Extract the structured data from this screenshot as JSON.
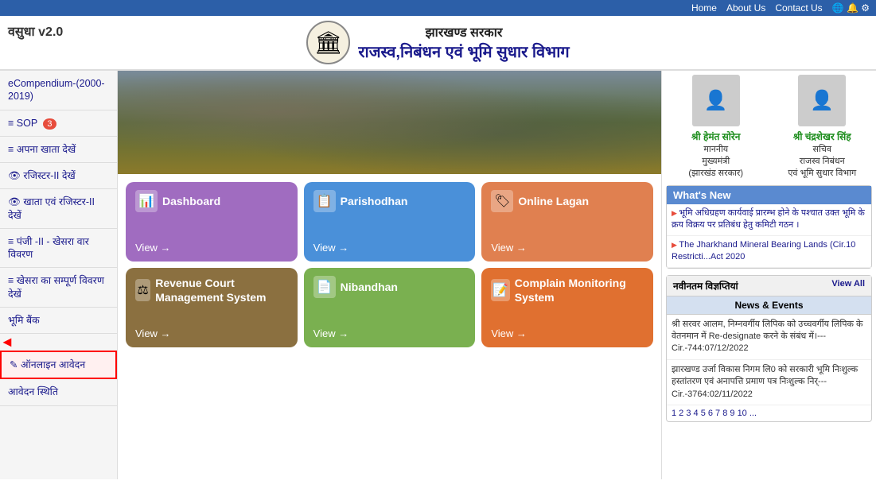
{
  "topnav": {
    "home": "Home",
    "about": "About Us",
    "contact": "Contact Us"
  },
  "brand": "वसुधा v2.0",
  "header": {
    "subtitle": "झारखण्ड सरकार",
    "main_title": "राजस्व,निबंधन एवं भूमि सुधार विभाग"
  },
  "sidebar": {
    "items": [
      {
        "id": "ecompendium",
        "label": "eCompendium-(2000-2019)"
      },
      {
        "id": "sop",
        "label": "SOP",
        "badge": "3"
      },
      {
        "id": "apna-khata",
        "label": "अपना खाता देखें"
      },
      {
        "id": "register2",
        "label": "रजिस्टर-II देखें"
      },
      {
        "id": "khata-register",
        "label": "खाता एवं रजिस्टर-II देखें"
      },
      {
        "id": "panji",
        "label": "पंजी -II - खेसरा वार विवरण"
      },
      {
        "id": "khesra-sampurn",
        "label": "खेसरा का सम्पूर्ण विवरण देखें"
      },
      {
        "id": "bhumi-bank",
        "label": "भूमि बैंक"
      },
      {
        "id": "online-avedan",
        "label": "ऑनलाइन आवेदन",
        "highlighted": true
      },
      {
        "id": "avedan-sthiti",
        "label": "आवेदन स्थिति"
      }
    ]
  },
  "modules": [
    {
      "id": "dashboard",
      "title": "Dashboard",
      "view": "View →",
      "class": "card-dashboard",
      "icon": "📊"
    },
    {
      "id": "parishodhan",
      "title": "Parishodhan",
      "view": "View →",
      "class": "card-parishodhan",
      "icon": "📋"
    },
    {
      "id": "online-lagan",
      "title": "Online Lagan",
      "view": "View →",
      "class": "card-lagan",
      "icon": "🏷"
    },
    {
      "id": "revenue-court",
      "title": "Revenue Court Management System",
      "view": "View →",
      "class": "card-revenue",
      "icon": "⚖"
    },
    {
      "id": "nibandhan",
      "title": "Nibandhan",
      "view": "View →",
      "class": "card-nibandhan",
      "icon": "📄"
    },
    {
      "id": "complain",
      "title": "Complain Monitoring System",
      "view": "View →",
      "class": "card-complain",
      "icon": "📝"
    }
  ],
  "officials": [
    {
      "id": "hemant-soren",
      "name": "श्री हेमंत सोरेन",
      "post1": "माननीय",
      "post2": "मुख्यमंत्री",
      "post3": "(झारखंड सरकार)",
      "emoji": "👤"
    },
    {
      "id": "chandreshekhar",
      "name": "श्री चंद्रशेखर सिंह",
      "post1": "सचिव",
      "post2": "राजस्व निबंधन",
      "post3": "एवं भूमि सुधार विभाग",
      "emoji": "👤"
    }
  ],
  "whats_new": {
    "title": "What's New",
    "items": [
      "भूमि अधिग्रहण कार्यवाई प्रारम्भ होने के पश्चात उक्त भूमि के क्रय विक्रय पर प्रतिबंध हेतु कमिटी गठन ।",
      "The Jharkhand Mineral Bearing Lands (Cir.10 Restricti...Act 2020"
    ]
  },
  "navinatam": {
    "title": "नवीनतम विज्ञप्तियां",
    "view_all": "View All",
    "table_header": "News & Events",
    "rows": [
      "श्री सरवर आलम, निम्नवर्गीय लिपिक को उच्चवर्गीय लिपिक के वेतनमान में Re-designate करने के संबंध में।---Cir.-744:07/12/2022",
      "झारखण्ड उर्जा विकास निगम लि0 को सरकारी भूमि निःशुल्क हस्तांतरण एवं अनापत्ति प्रमाण पत्र निःशुल्क निर्---Cir.-3764:02/11/2022"
    ],
    "pagination": "1 2 3 4 5 6 7 8 9 10 ..."
  }
}
